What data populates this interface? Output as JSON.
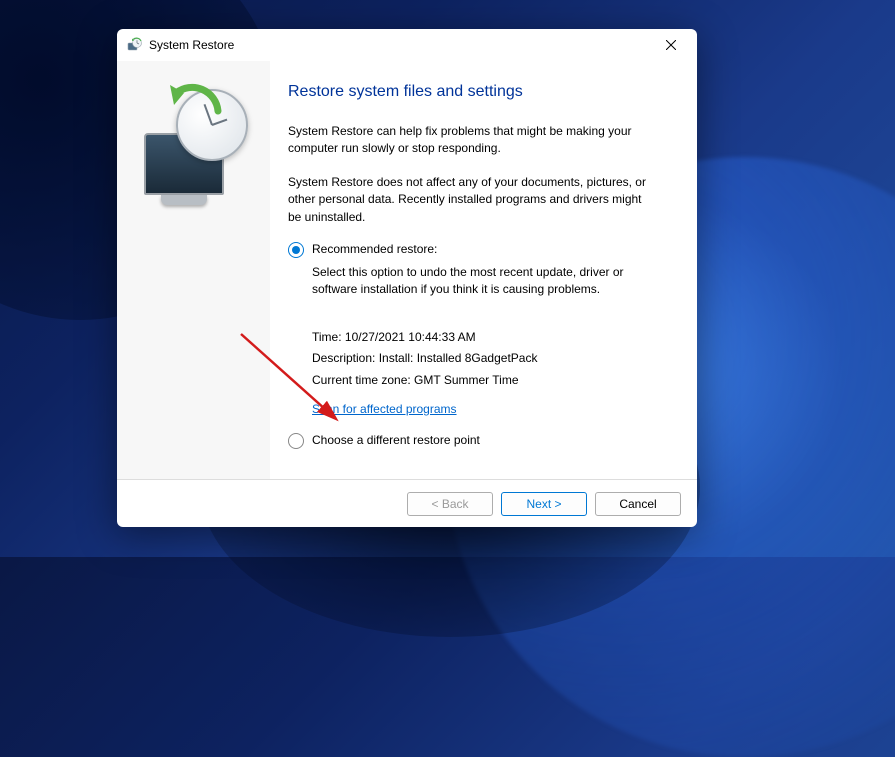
{
  "titlebar": {
    "title": "System Restore"
  },
  "content": {
    "heading": "Restore system files and settings",
    "para1": "System Restore can help fix problems that might be making your computer run slowly or stop responding.",
    "para2": "System Restore does not affect any of your documents, pictures, or other personal data. Recently installed programs and drivers might be uninstalled."
  },
  "options": {
    "recommended": {
      "label": "Recommended restore:",
      "desc": "Select this option to undo the most recent update, driver or software installation if you think it is causing problems."
    },
    "different": {
      "label": "Choose a different restore point"
    }
  },
  "details": {
    "time": "Time: 10/27/2021 10:44:33 AM",
    "description": "Description: Install: Installed 8GadgetPack",
    "timezone": "Current time zone: GMT Summer Time",
    "scan_link": "Scan for affected programs"
  },
  "footer": {
    "back": "< Back",
    "next": "Next >",
    "cancel": "Cancel"
  }
}
